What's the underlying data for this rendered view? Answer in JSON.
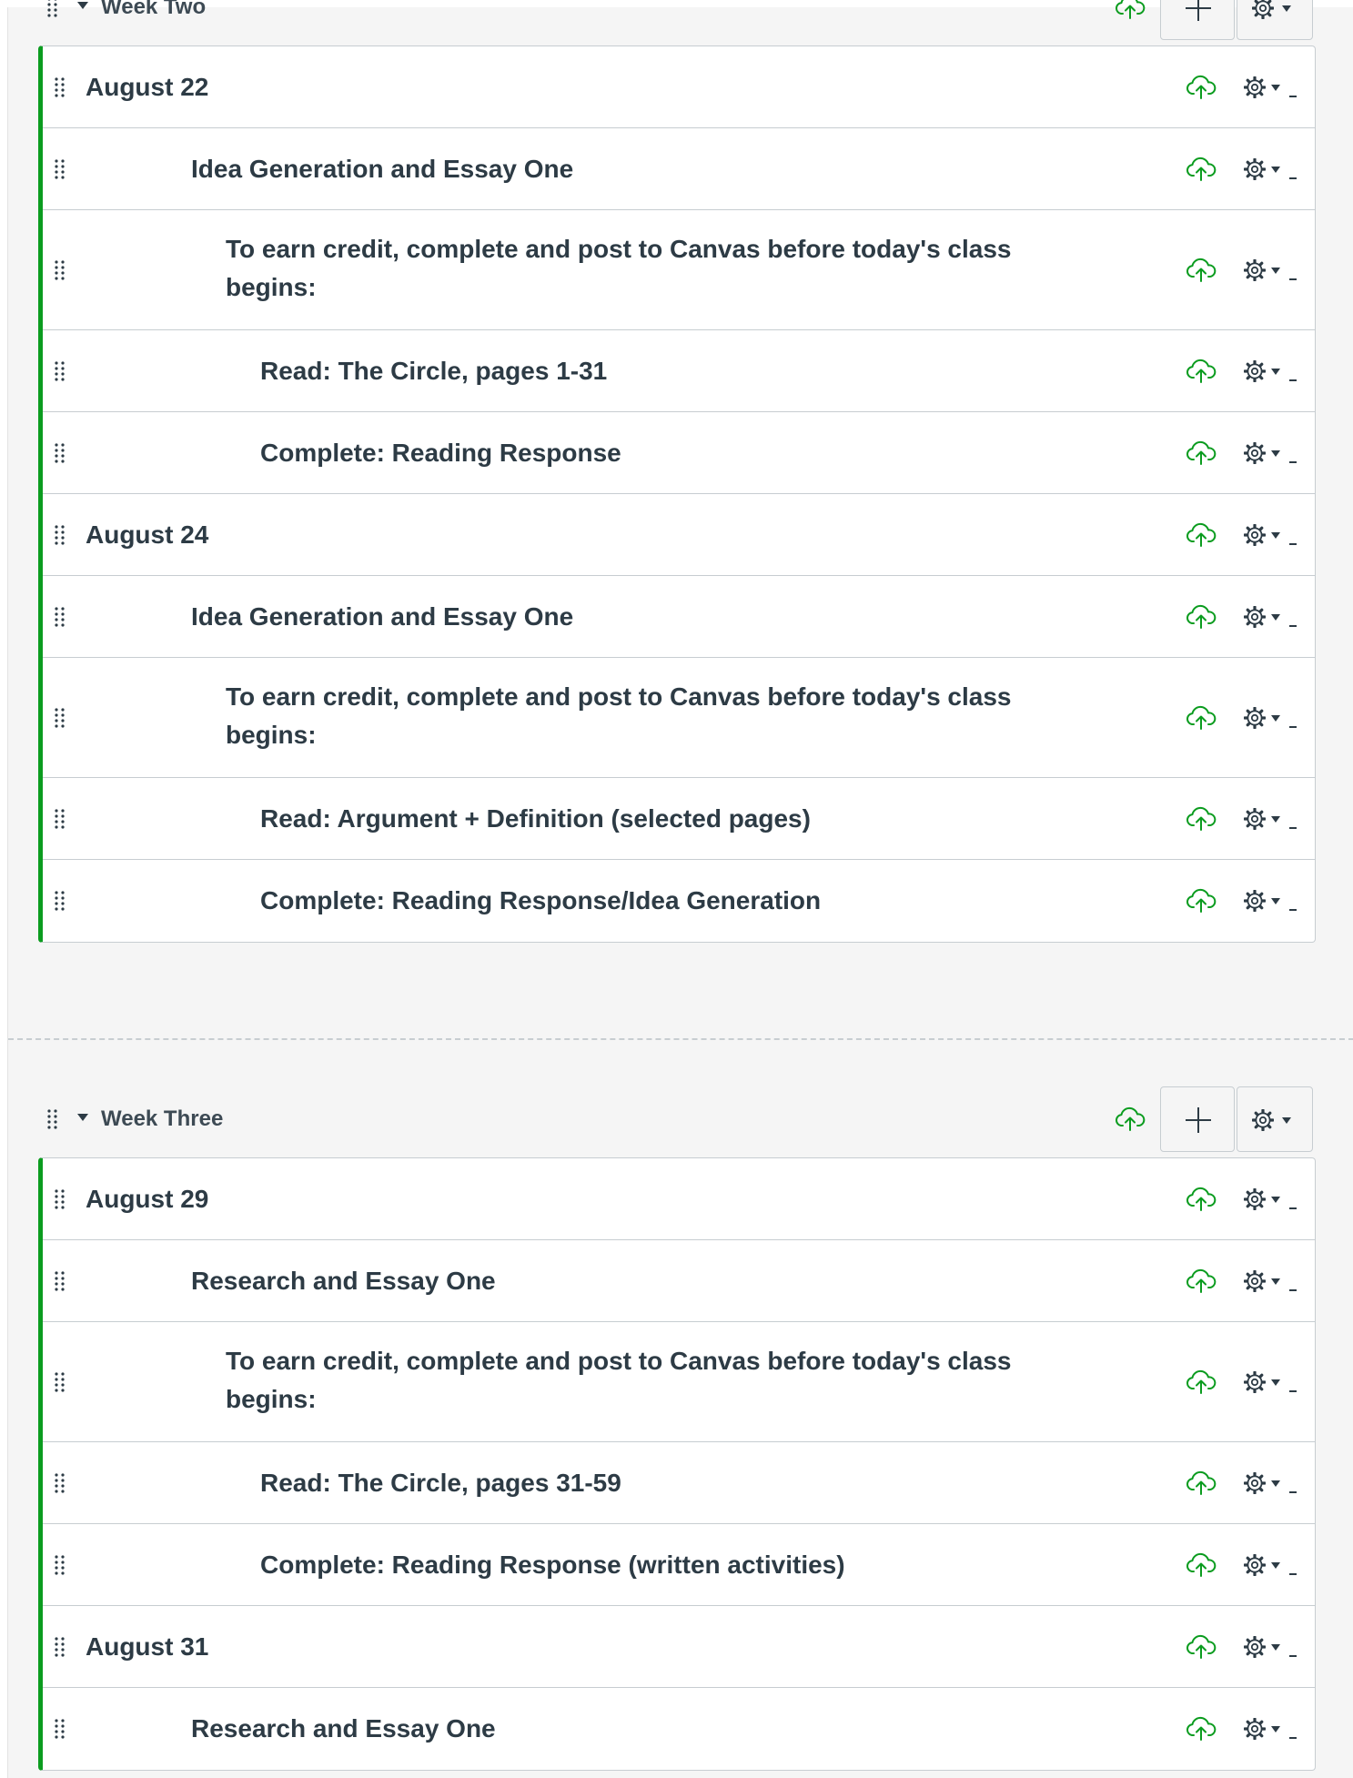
{
  "colors": {
    "accent_green": "#0b9c1f",
    "cloud_green": "#0b9c1f",
    "text": "#2d3b45",
    "border": "#c7cdd1",
    "background": "#f5f5f5"
  },
  "icons": {
    "drag": "drag-handle-icon",
    "caret": "caret-down-icon",
    "publish": "cloud-upload-icon",
    "add": "plus-icon",
    "settings": "gear-icon"
  },
  "modules": [
    {
      "title": "Week Two",
      "items": [
        {
          "title": "August 22",
          "indent": 0
        },
        {
          "title": "Idea Generation and Essay One",
          "indent": 1
        },
        {
          "title": "To earn credit, complete and post to Canvas before today's class begins:",
          "indent": 2
        },
        {
          "title": "Read: The Circle, pages 1-31",
          "indent": 3
        },
        {
          "title": "Complete: Reading Response",
          "indent": 3
        },
        {
          "title": "August 24",
          "indent": 0
        },
        {
          "title": "Idea Generation and Essay One",
          "indent": 1
        },
        {
          "title": "To earn credit, complete and post to Canvas before today's class begins:",
          "indent": 2
        },
        {
          "title": "Read: Argument + Definition (selected pages)",
          "indent": 3
        },
        {
          "title": "Complete: Reading Response/Idea Generation",
          "indent": 3
        }
      ]
    },
    {
      "title": "Week Three",
      "items": [
        {
          "title": "August 29",
          "indent": 0
        },
        {
          "title": "Research and Essay One",
          "indent": 1
        },
        {
          "title": "To earn credit, complete and post to Canvas before today's class begins:",
          "indent": 2
        },
        {
          "title": "Read: The Circle, pages 31-59",
          "indent": 3
        },
        {
          "title": "Complete: Reading Response (written activities)",
          "indent": 3
        },
        {
          "title": "August 31",
          "indent": 0
        },
        {
          "title": "Research and Essay One",
          "indent": 1
        }
      ]
    }
  ]
}
